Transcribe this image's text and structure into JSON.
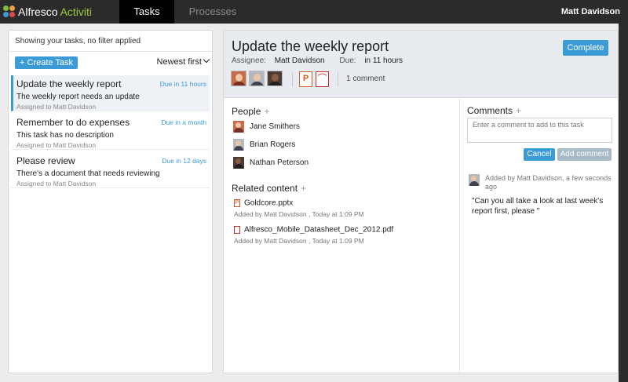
{
  "topbar": {
    "brand": "Alfresco",
    "brand_accent": "Activiti",
    "tabs": [
      {
        "label": "Tasks",
        "active": true
      },
      {
        "label": "Processes",
        "active": false
      }
    ],
    "user": "Matt Davidson"
  },
  "task_list": {
    "filter_text": "Showing your tasks, no filter applied",
    "create_label": "+ Create Task",
    "sort_label": "Newest first",
    "tasks": [
      {
        "title": "Update the weekly report",
        "due": "Due in 11 hours",
        "description": "The weekly report needs an update",
        "assigned": "Assigned to Matt Davidson",
        "selected": true
      },
      {
        "title": "Remember to do expenses",
        "due": "Due in a month",
        "description": "This task has no description",
        "assigned": "Assigned to Matt Davidson",
        "selected": false
      },
      {
        "title": "Please review",
        "due": "Due in 12 days",
        "description": "There's a document that needs reviewing",
        "assigned": "Assigned to Matt Davidson",
        "selected": false
      }
    ]
  },
  "detail": {
    "title": "Update the weekly report",
    "assignee_label": "Assignee:",
    "assignee": "Matt Davidson",
    "due_label": "Due:",
    "due": "in 11 hours",
    "complete_label": "Complete",
    "comment_count": "1 comment",
    "people_heading": "People",
    "people": [
      "Jane Smithers",
      "Brian Rogers",
      "Nathan Peterson"
    ],
    "related_heading": "Related content",
    "related": [
      {
        "name": "Goldcore.pptx",
        "meta": "Added by Matt Davidson , Today at 1:09 PM",
        "icon": "ppt-file-icon"
      },
      {
        "name": "Alfresco_Mobile_Datasheet_Dec_2012.pdf",
        "meta": "Added by Matt Davidson , Today at 1:09 PM",
        "icon": "pdf-file-icon"
      }
    ],
    "comments_heading": "Comments",
    "comment_placeholder": "Enter a comment to add to this task",
    "cancel_label": "Cancel",
    "add_comment_label": "Add comment",
    "comments": [
      {
        "meta": "Added by Matt Davidson, a few seconds ago",
        "text": "\"Can you all take a look at last week's report first, please \""
      }
    ]
  },
  "colors": {
    "accent": "#3a9bd6",
    "topbar": "#2b2b2b",
    "brand_accent": "#9ccc3c"
  }
}
